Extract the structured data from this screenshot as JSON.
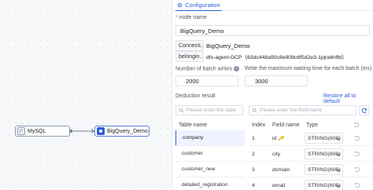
{
  "canvas": {
    "nodes": [
      {
        "label": "MySQL"
      },
      {
        "label": "BigQuery_Demo"
      }
    ]
  },
  "panel": {
    "tab_label": "Configuration",
    "node_name": {
      "label": "node name",
      "value": "BigQuery_Demo"
    },
    "connection": {
      "prefix": "Connecti...",
      "value": "BigQuery_Demo"
    },
    "belonging": {
      "prefix": "belongin...",
      "value": "dfs-agent-GCP（63dc448a90c8e908c6f5d2e3-1jqra6nfbt）"
    },
    "batch_writes": {
      "label": "Number of batch writes",
      "value": "2000"
    },
    "wait_time": {
      "label": "Write the maximum waiting time for each batch (ms)",
      "value": "3000"
    },
    "deduction": {
      "label": "Deduction result",
      "restore_label": "Restore all to default",
      "table_search_placeholder": "Please enter the table",
      "field_search_placeholder": "Please enter the field name",
      "columns": {
        "table_name": "Table name",
        "index": "Index",
        "field_name": "Field name",
        "type": "Type"
      },
      "tables": [
        "company",
        "customer",
        "customer_new",
        "detailed_registration"
      ],
      "fields": [
        {
          "index": "1",
          "name": "id",
          "type": "STRING(600)"
        },
        {
          "index": "2",
          "name": "city",
          "type": "STRING(600)"
        },
        {
          "index": "3",
          "name": "domain",
          "type": "STRING(600)"
        },
        {
          "index": "4",
          "name": "email",
          "type": "STRING(600)"
        }
      ]
    }
  },
  "colors": {
    "accent": "#2b5fd9",
    "required": "#e34d59"
  }
}
